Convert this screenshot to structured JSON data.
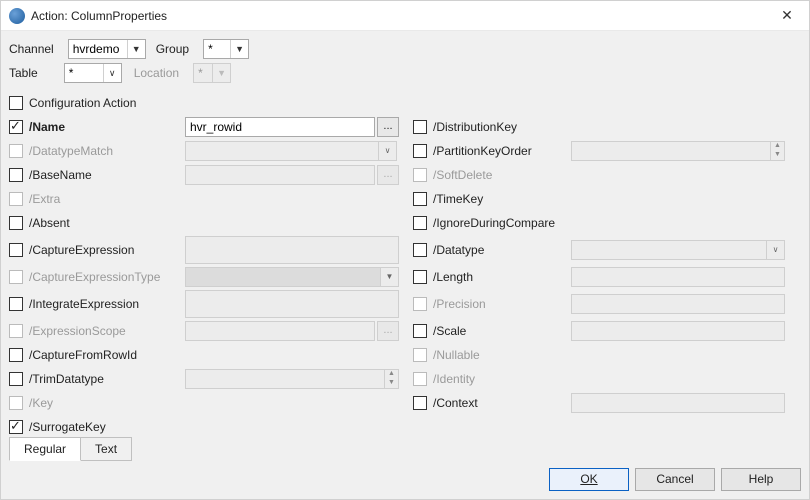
{
  "titlebar": {
    "title": "Action: ColumnProperties",
    "close": "✕"
  },
  "header": {
    "channel_label": "Channel",
    "channel_value": "hvrdemo",
    "group_label": "Group",
    "group_value": "*",
    "table_label": "Table",
    "table_value": "*",
    "location_label": "Location",
    "location_value": "*"
  },
  "props": {
    "configuration_action": "Configuration Action",
    "name_label": "/Name",
    "name_value": "hvr_rowid",
    "datatype_match": "/DatatypeMatch",
    "base_name": "/BaseName",
    "extra": "/Extra",
    "absent": "/Absent",
    "capture_expression": "/CaptureExpression",
    "capture_expression_type": "/CaptureExpressionType",
    "integrate_expression": "/IntegrateExpression",
    "expression_scope": "/ExpressionScope",
    "capture_from_rowid": "/CaptureFromRowId",
    "trim_datatype": "/TrimDatatype",
    "key": "/Key",
    "surrogate_key": "/SurrogateKey",
    "distribution_key": "/DistributionKey",
    "partition_key_order": "/PartitionKeyOrder",
    "soft_delete": "/SoftDelete",
    "time_key": "/TimeKey",
    "ignore_during_compare": "/IgnoreDuringCompare",
    "datatype": "/Datatype",
    "length": "/Length",
    "precision": "/Precision",
    "scale": "/Scale",
    "nullable": "/Nullable",
    "identity": "/Identity",
    "context": "/Context",
    "dots": "..."
  },
  "tabs": {
    "regular": "Regular",
    "text": "Text"
  },
  "buttons": {
    "ok": "OK",
    "cancel": "Cancel",
    "help": "Help"
  }
}
